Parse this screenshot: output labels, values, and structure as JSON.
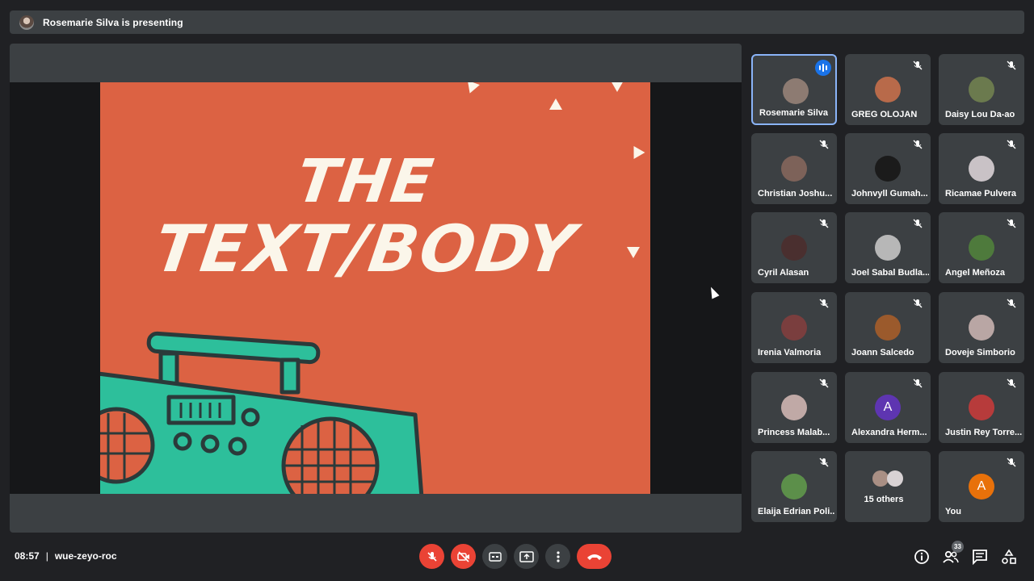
{
  "presenting": {
    "text": "Rosemarie Silva is presenting"
  },
  "slide": {
    "line1": "THE",
    "line2": "TEXT/BODY"
  },
  "participants": [
    {
      "name": "Rosemarie Silva",
      "speaking": true,
      "color": "#8d7b72"
    },
    {
      "name": "GREG OLOJAN",
      "color": "#b86a4a"
    },
    {
      "name": "Daisy Lou Da-ao",
      "color": "#6b7a4e"
    },
    {
      "name": "Christian Joshu...",
      "color": "#7d6259"
    },
    {
      "name": "Johnvyll Gumah...",
      "color": "#1b1b1b"
    },
    {
      "name": "Ricamae Pulvera",
      "color": "#c9c2c6"
    },
    {
      "name": "Cyril Alasan",
      "color": "#4a2f2f"
    },
    {
      "name": "Joel Sabal Budla...",
      "color": "#b7b7b7"
    },
    {
      "name": "Angel Meñoza",
      "color": "#4e7a3c"
    },
    {
      "name": "Irenia Valmoria",
      "color": "#7a3e3e"
    },
    {
      "name": "Joann Salcedo",
      "color": "#9b5a2c"
    },
    {
      "name": "Doveje Simborio",
      "color": "#b9a6a4"
    },
    {
      "name": "Princess Malab...",
      "color": "#c0a9a6"
    },
    {
      "name": "Alexandra Herm...",
      "letter": "A",
      "color": "#5e35b1"
    },
    {
      "name": "Justin Rey Torre...",
      "color": "#b73b3b"
    },
    {
      "name": "Elaija Edrian Poli...",
      "color": "#5c8f4a"
    },
    {
      "name": "15 others"
    },
    {
      "name": "You",
      "letter": "A",
      "color": "#e8710a"
    }
  ],
  "meeting": {
    "time": "08:57",
    "separator": "|",
    "code": "wue-zeyo-roc"
  },
  "people_count": "33",
  "colors": {
    "accent_blue": "#1a73e8",
    "red": "#ea4335",
    "slide_orange": "#dc6243",
    "boombox_teal": "#2dbf9b"
  }
}
